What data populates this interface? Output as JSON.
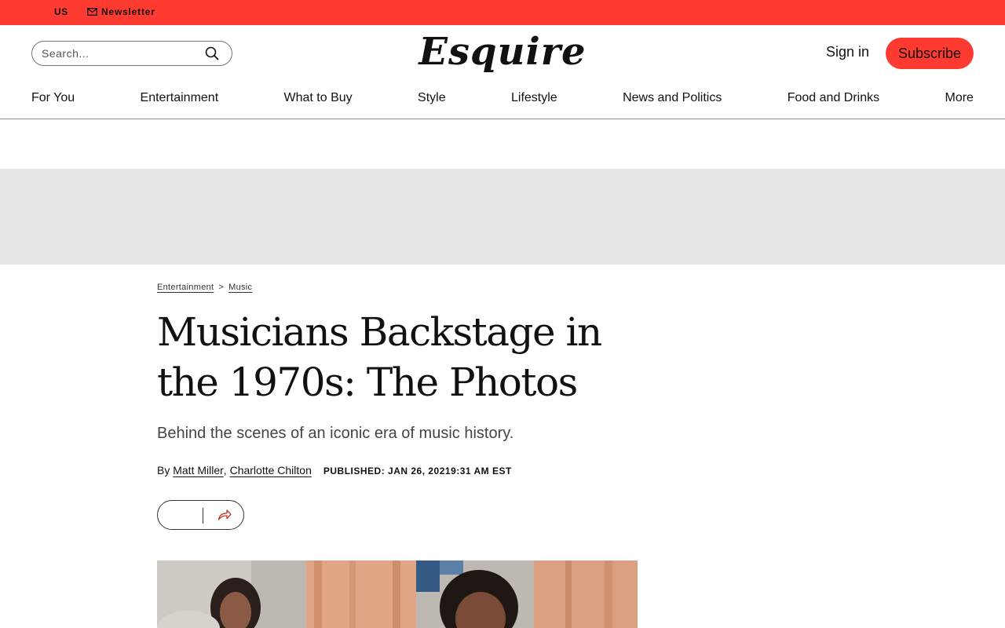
{
  "topbar": {
    "region": "US",
    "newsletter": "Newsletter",
    "color": "#ff3a30"
  },
  "search": {
    "placeholder": "Search..."
  },
  "brand": {
    "logo_text": "Esquire"
  },
  "account": {
    "signin": "Sign in",
    "subscribe": "Subscribe"
  },
  "nav": [
    "For You",
    "Entertainment",
    "What to Buy",
    "Style",
    "Lifestyle",
    "News and Politics",
    "Food and Drinks",
    "More"
  ],
  "article": {
    "breadcrumb": [
      "Entertainment",
      "Music"
    ],
    "breadcrumb_sep": ">",
    "headline_line1": "Musicians Backstage in",
    "headline_line2": "the 1970s: The Photos",
    "dek": "Behind the scenes of an iconic era of music history.",
    "byline_prefix": "By",
    "authors": [
      "Matt Miller",
      "Charlotte Chilton"
    ],
    "published": "PUBLISHED: JAN 26, 20219:31 AM EST"
  }
}
